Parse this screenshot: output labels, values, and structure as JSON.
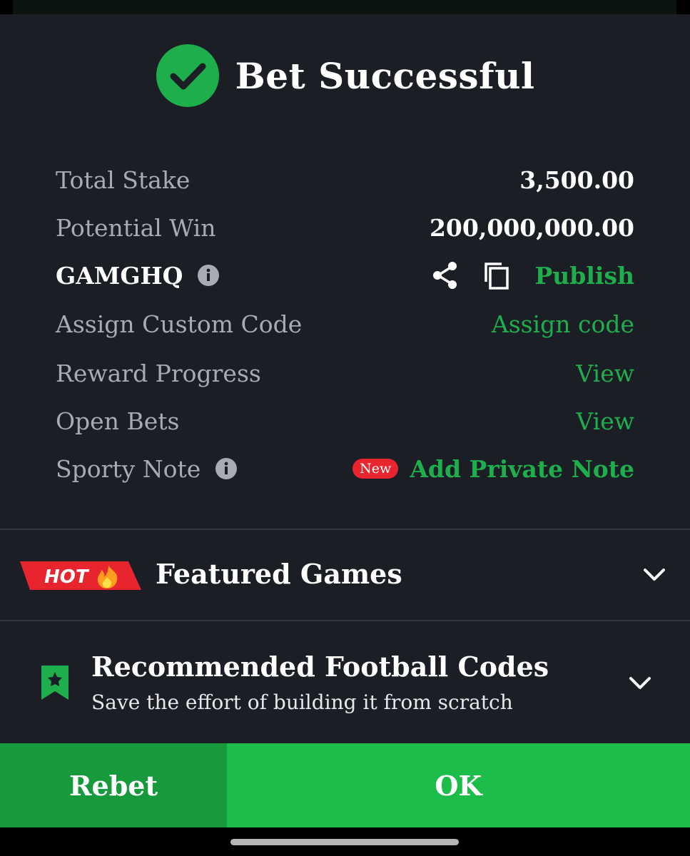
{
  "header": {
    "title": "Bet Successful"
  },
  "details": {
    "total_stake": {
      "label": "Total Stake",
      "value": "3,500.00"
    },
    "potential_win": {
      "label": "Potential Win",
      "value": "200,000,000.00"
    },
    "booking": {
      "code": "GAMGHQ",
      "publish_label": "Publish"
    },
    "custom_code": {
      "label": "Assign Custom Code",
      "action": "Assign code"
    },
    "reward_progress": {
      "label": "Reward Progress",
      "action": "View"
    },
    "open_bets": {
      "label": "Open Bets",
      "action": "View"
    },
    "sporty_note": {
      "label": "Sporty Note",
      "badge": "New",
      "action": "Add Private Note"
    }
  },
  "featured": {
    "badge": "HOT",
    "title": "Featured Games"
  },
  "recommended": {
    "title": "Recommended Football Codes",
    "subtitle": "Save the effort of building it from scratch"
  },
  "footer": {
    "rebet_label": "Rebet",
    "ok_label": "OK"
  },
  "colors": {
    "background": "#1b1e25",
    "accent_green": "#1fae4c",
    "button_green": "#1dbd4a",
    "rebet_green": "#169a3b",
    "badge_red": "#e8252f"
  },
  "icons": [
    "check-circle-icon",
    "info-icon",
    "share-icon",
    "copy-icon",
    "fire-icon",
    "bookmark-star-icon",
    "chevron-down-icon"
  ]
}
